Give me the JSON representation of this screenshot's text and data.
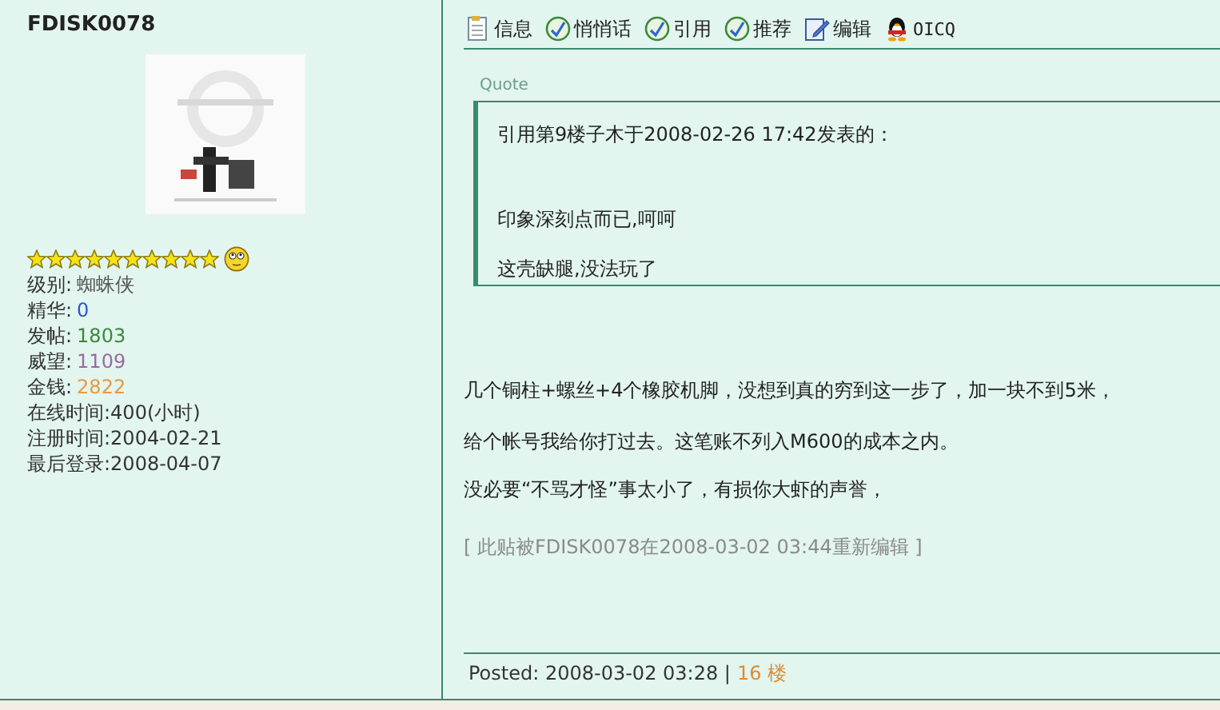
{
  "author": {
    "name": "FDISK0078",
    "stars": 10,
    "stats": [
      {
        "label": "级别:",
        "value": "蜘蛛侠",
        "color": "#555555"
      },
      {
        "label": "精华:",
        "value": "0",
        "color": "#2a55cc"
      },
      {
        "label": "发帖:",
        "value": "1803",
        "color": "#3a8a3a"
      },
      {
        "label": "威望:",
        "value": "1109",
        "color": "#9a6aa0"
      },
      {
        "label": "金钱:",
        "value": "2822",
        "color": "#e89a40"
      }
    ],
    "details": [
      "在线时间:400(小时)",
      "注册时间:2004-02-21",
      "最后登录:2008-04-07"
    ]
  },
  "toolbar": [
    {
      "label": "信息",
      "kind": "document"
    },
    {
      "label": "悄悄话",
      "kind": "check"
    },
    {
      "label": "引用",
      "kind": "check"
    },
    {
      "label": "推荐",
      "kind": "check"
    },
    {
      "label": "编辑",
      "kind": "edit"
    },
    {
      "label": "OICQ",
      "kind": "penguin"
    }
  ],
  "quote": {
    "title": "Quote",
    "header": "引用第9楼子木于2008-02-26 17:42发表的：",
    "lines": [
      "印象深刻点而已,呵呵",
      "这壳缺腿,没法玩了"
    ]
  },
  "body": [
    "几个铜柱+螺丝+4个橡胶机脚，没想到真的穷到这一步了，加一块不到5米，",
    "给个帐号我给你打过去。这笔账不列入M600的成本之内。",
    "没必要“不骂才怪”事太小了，有损你大虾的声誉，"
  ],
  "edited": "[ 此贴被FDISK0078在2008-03-02 03:44重新编辑 ]",
  "footer": {
    "posted": "Posted: 2008-03-02 03:28 |",
    "floor": "16 楼"
  }
}
